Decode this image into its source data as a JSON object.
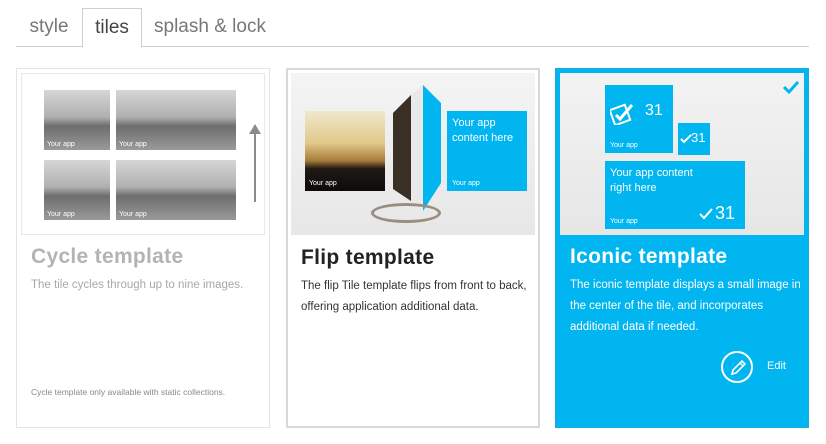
{
  "tabs": [
    {
      "label": "style"
    },
    {
      "label": "tiles"
    },
    {
      "label": "splash & lock"
    }
  ],
  "cards": {
    "cycle": {
      "title": "Cycle template",
      "description": "The tile cycles through up to nine images.",
      "note": "Cycle template only available with static collections.",
      "tile_label": "Your app"
    },
    "flip": {
      "title": "Flip template",
      "description": "The flip Tile template flips from front to back, offering application additional data.",
      "tile_label": "Your app",
      "content_text": "Your app content here"
    },
    "iconic": {
      "title": "Iconic template",
      "description": "The iconic template displays a small image in the center of the tile, and incorporates additional data if needed.",
      "tile_label": "Your app",
      "count": "31",
      "content_text": "Your app content right here",
      "edit_label": "Edit",
      "selected": true
    }
  },
  "colors": {
    "accent": "#00b5f0",
    "tab_text": "#777777"
  },
  "icons": [
    "checkmark-icon",
    "pencil-icon",
    "up-arrow-icon"
  ]
}
